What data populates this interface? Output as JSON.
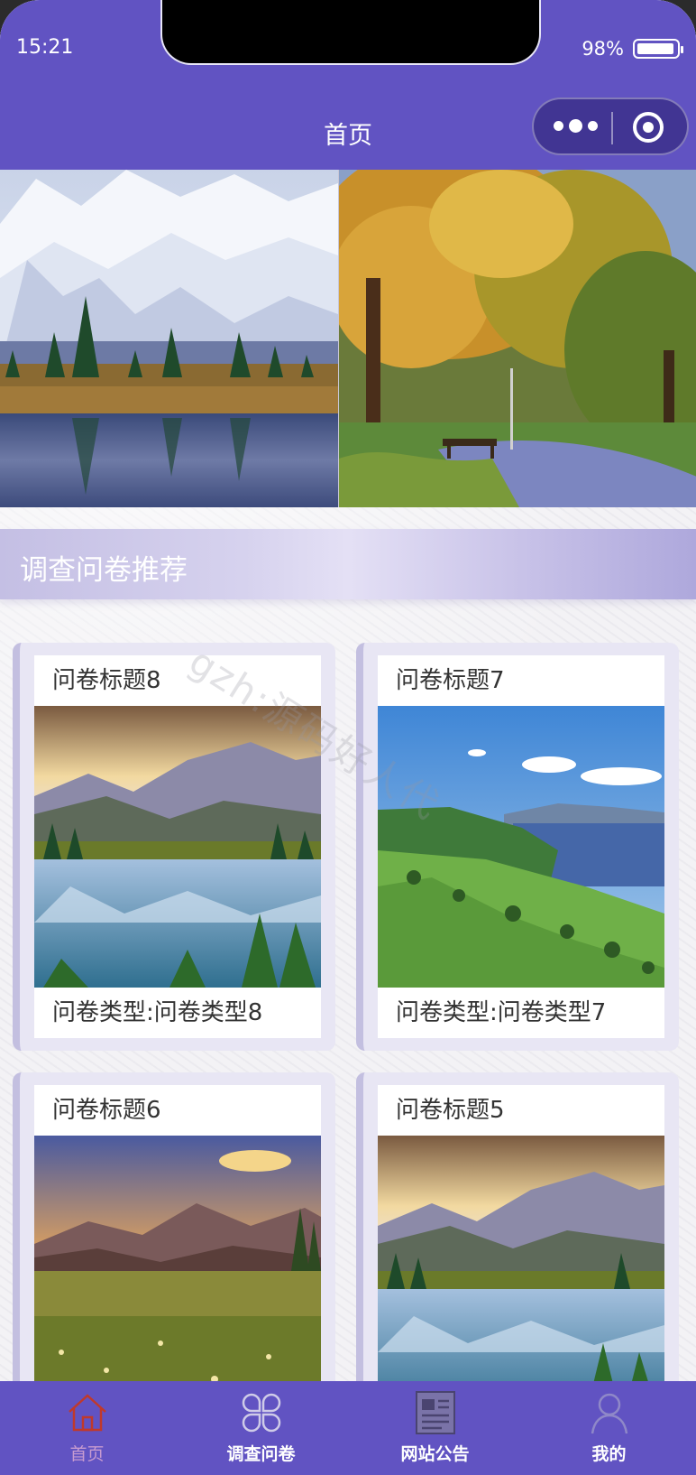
{
  "status_bar": {
    "time": "15:21",
    "battery": "98%",
    "battery_level": 0.98
  },
  "nav": {
    "title": "首页"
  },
  "section": {
    "title": "调查问卷推荐"
  },
  "cards": [
    {
      "title": "问卷标题8",
      "type": "问卷类型:问卷类型8"
    },
    {
      "title": "问卷标题7",
      "type": "问卷类型:问卷类型7"
    },
    {
      "title": "问卷标题6",
      "type": ""
    },
    {
      "title": "问卷标题5",
      "type": ""
    }
  ],
  "watermark": "gzh:源码好人代",
  "tabbar": {
    "items": [
      {
        "label": "首页",
        "icon": "home-icon",
        "active": true
      },
      {
        "label": "调查问卷",
        "icon": "clover-grid-icon",
        "active": false
      },
      {
        "label": "网站公告",
        "icon": "newspaper-icon",
        "active": false
      },
      {
        "label": "我的",
        "icon": "user-icon",
        "active": false
      }
    ]
  },
  "colors": {
    "primary": "#6153c2",
    "active_tab": "#c79bd0",
    "card_bg": "#e8e6f4"
  }
}
